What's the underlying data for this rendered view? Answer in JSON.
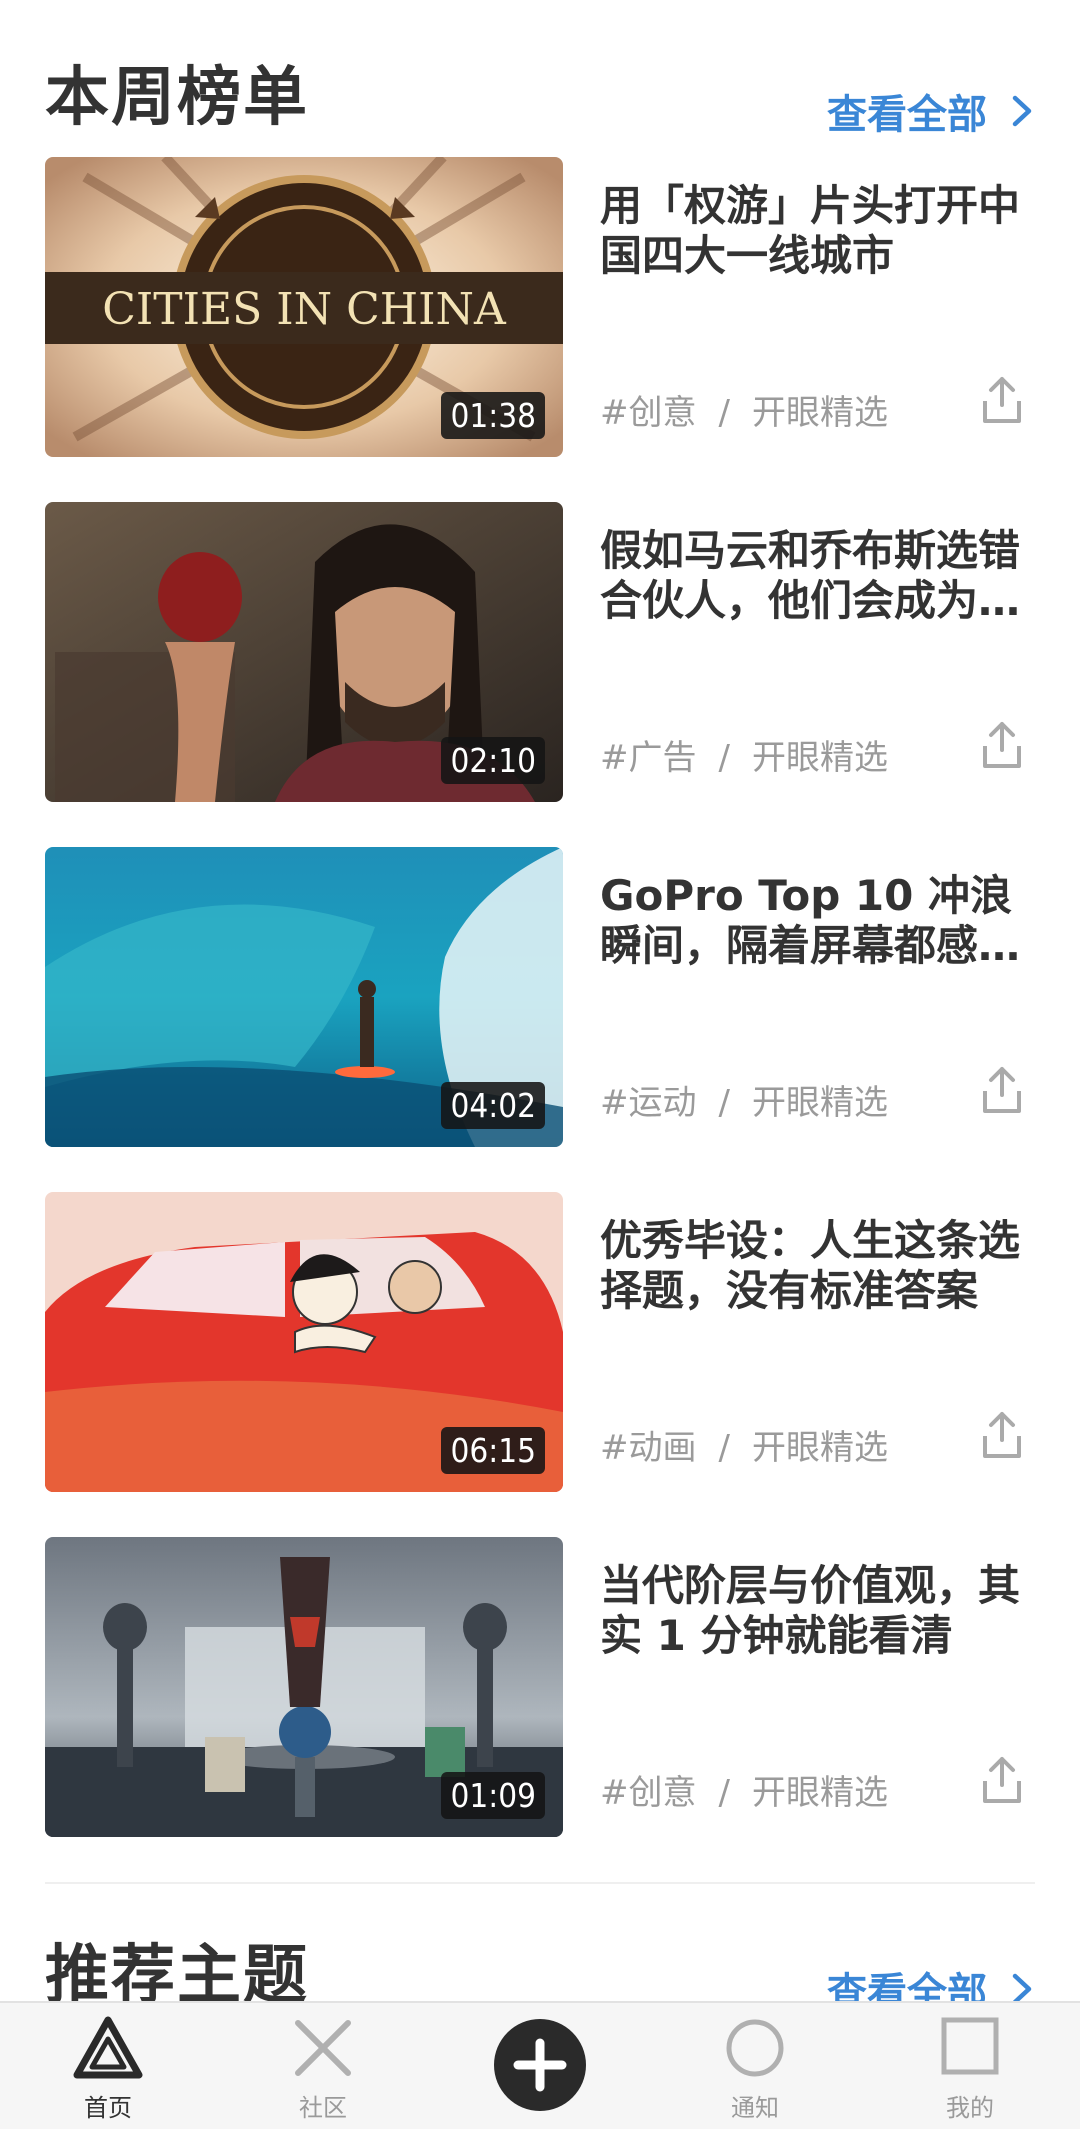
{
  "ranking": {
    "title": "本周榜单",
    "see_all": "查看全部",
    "videos": [
      {
        "title": "用「权游」片头打开中国四大一线城市",
        "duration": "01:38",
        "category": "#创意",
        "author": "开眼精选",
        "thumb_text": "CITIES IN CHINA"
      },
      {
        "title": "假如马云和乔布斯选错合伙人，他们会成为…",
        "duration": "02:10",
        "category": "#广告",
        "author": "开眼精选"
      },
      {
        "title": "GoPro Top 10 冲浪瞬间，隔着屏幕都感…",
        "duration": "04:02",
        "category": "#运动",
        "author": "开眼精选"
      },
      {
        "title": "优秀毕设：人生这条选择题，没有标准答案",
        "duration": "06:15",
        "category": "#动画",
        "author": "开眼精选"
      },
      {
        "title": "当代阶层与价值观，其实 1 分钟就能看清",
        "duration": "01:09",
        "category": "#创意",
        "author": "开眼精选"
      }
    ],
    "separator": "/"
  },
  "recommend": {
    "title": "推荐主题",
    "see_all": "查看全部"
  },
  "tabbar": {
    "items": [
      {
        "label": "首页",
        "icon": "triangle-icon",
        "active": true
      },
      {
        "label": "社区",
        "icon": "cross-icon",
        "active": false
      },
      {
        "label": "",
        "icon": "plus-icon",
        "active": false
      },
      {
        "label": "通知",
        "icon": "circle-icon",
        "active": false
      },
      {
        "label": "我的",
        "icon": "square-icon",
        "active": false
      }
    ]
  },
  "colors": {
    "accent": "#3a86d6",
    "text": "#333333",
    "meta": "#9a9a9a"
  }
}
